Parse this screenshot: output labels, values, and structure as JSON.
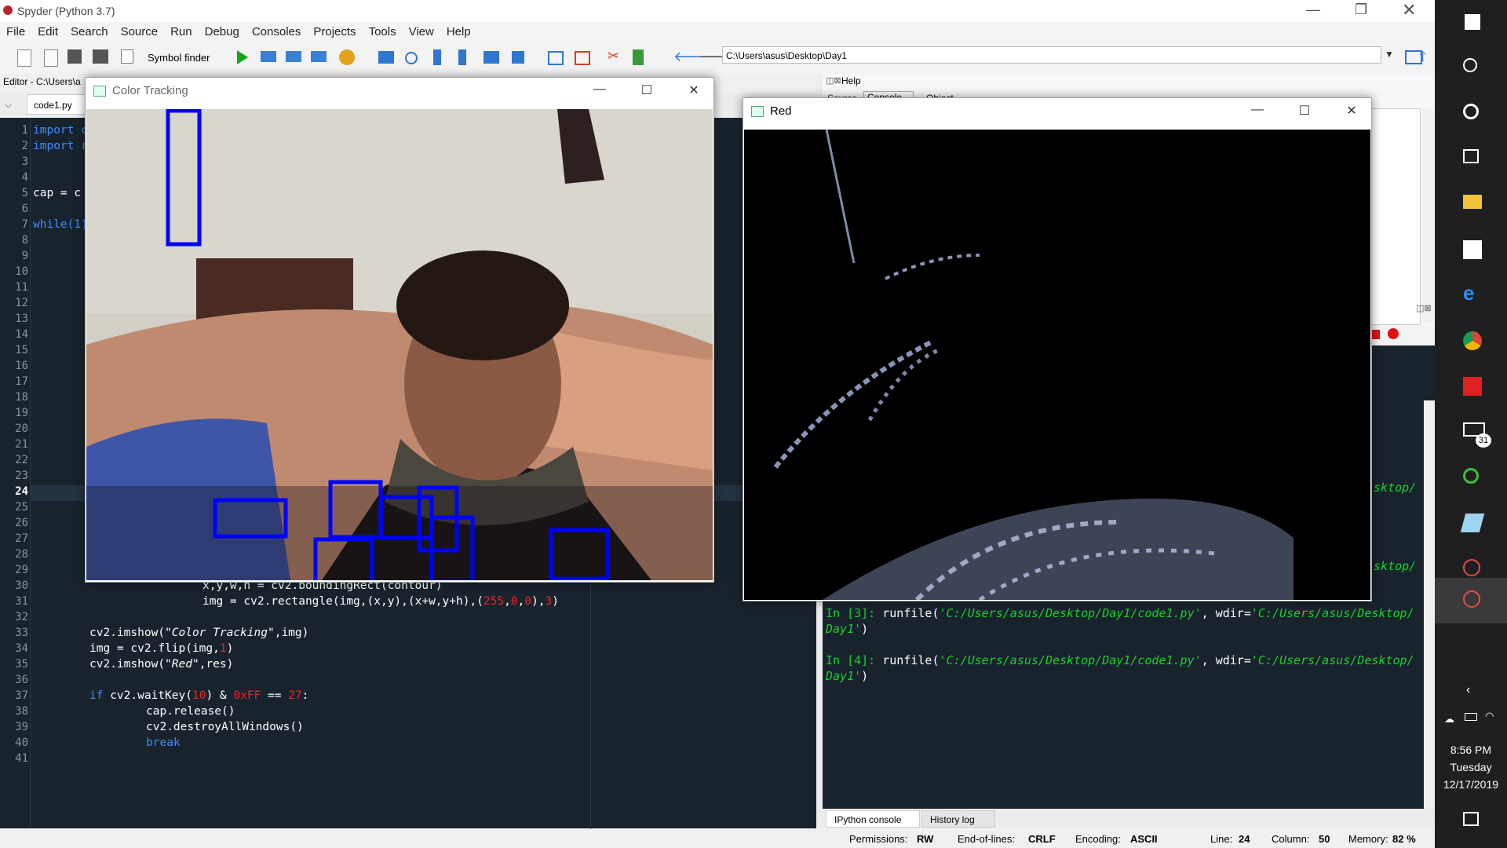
{
  "window": {
    "title": "Spyder (Python 3.7)"
  },
  "menu": [
    "File",
    "Edit",
    "Search",
    "Source",
    "Run",
    "Debug",
    "Consoles",
    "Projects",
    "Tools",
    "View",
    "Help"
  ],
  "toolbar": {
    "symbol_finder": "Symbol finder",
    "path": "C:\\Users\\asus\\Desktop\\Day1"
  },
  "editor": {
    "header": "Editor - C:\\Users\\a",
    "tab": "code1.py",
    "line_numbers": [
      "1",
      "2",
      "3",
      "4",
      "5",
      "6",
      "7",
      "8",
      "9",
      "10",
      "11",
      "12",
      "13",
      "14",
      "15",
      "16",
      "17",
      "18",
      "19",
      "20",
      "21",
      "22",
      "23",
      "24",
      "25",
      "26",
      "27",
      "28",
      "29",
      "30",
      "31",
      "32",
      "33",
      "34",
      "35",
      "36",
      "37",
      "38",
      "39",
      "40",
      "41"
    ],
    "visible_left": {
      "l1": "import c",
      "l2": "import r",
      "l5": "cap = c",
      "l7": "while(1)"
    },
    "code": {
      "l30": "x,y,w,h = cv2.boundingRect(contour)",
      "l31a": "img = cv2.rectangle(img,(x,y),(x+w,y+h),(",
      "l31n1": "255",
      "l31n2": "0",
      "l31n3": "0",
      "l31n4": "3",
      "l33a": "cv2.imshow(",
      "l33s": "\"Color Tracking\"",
      "l33b": ",img)",
      "l34a": "img = cv2.flip(img,",
      "l34n": "1",
      "l34b": ")",
      "l35a": "cv2.imshow(",
      "l35s": "\"Red\"",
      "l35b": ",res)",
      "l37k": "if",
      "l37a": " cv2.waitKey(",
      "l37n": "10",
      "l37b": ") & ",
      "l37h": "0xFF",
      "l37c": " == ",
      "l37d": "27",
      "l37e": ":",
      "l38": "cap.release()",
      "l39": "cv2.destroyAllWindows()",
      "l40": "break"
    }
  },
  "help_pane": {
    "title": "Help",
    "source_label": "Source",
    "source_value": "Console",
    "object_label": "Object"
  },
  "console": {
    "partial1": "sktop/",
    "partial2": "sktop/",
    "in3_prompt": "In [3]:",
    "in3_cmd": " runfile(",
    "in3_arg": "'C:/Users/asus/Desktop/Day1/code1.py'",
    "in3_mid": ", wdir=",
    "in3_wdir": "'C:/Users/asus/Desktop/",
    "in3_wdir2": "Day1'",
    "in3_close": ")",
    "in4_prompt": "In [4]:",
    "in4_cmd": " runfile(",
    "in4_arg": "'C:/Users/asus/Desktop/Day1/code1.py'",
    "in4_mid": ", wdir=",
    "in4_wdir": "'C:/Users/asus/Desktop/",
    "in4_wdir2": "Day1'",
    "in4_close": ")",
    "tabs": [
      "IPython console",
      "History log"
    ]
  },
  "statusbar": {
    "permissions_label": "Permissions:",
    "permissions": "RW",
    "eol_label": "End-of-lines:",
    "eol": "CRLF",
    "encoding_label": "Encoding:",
    "encoding": "ASCII",
    "line_label": "Line:",
    "line": "24",
    "column_label": "Column:",
    "column": "50",
    "memory_label": "Memory:",
    "memory": "82 %"
  },
  "color_tracking_window": {
    "title": "Color Tracking"
  },
  "red_window": {
    "title": "Red"
  },
  "taskbar": {
    "time": "8:56 PM",
    "day": "Tuesday",
    "date": "12/17/2019",
    "mail_badge": "31"
  },
  "colors": {
    "editor_bg": "#19232d",
    "keyword": "#3c8dff",
    "number": "#e62727",
    "prompt": "#17d12a",
    "box": "#0000ff"
  }
}
